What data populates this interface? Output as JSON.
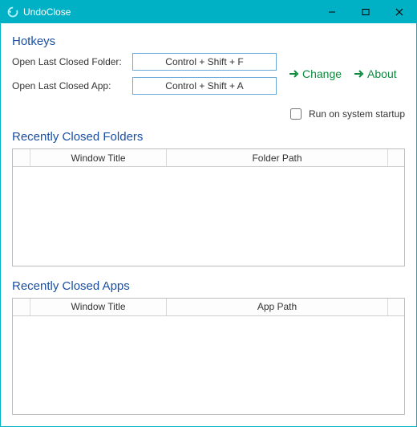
{
  "window": {
    "title": "UndoClose"
  },
  "hotkeys": {
    "section_title": "Hotkeys",
    "folder_label": "Open Last Closed Folder:",
    "folder_value": "Control + Shift + F",
    "app_label": "Open Last Closed App:",
    "app_value": "Control + Shift + A"
  },
  "buttons": {
    "change": "Change",
    "about": "About"
  },
  "startup": {
    "label": "Run on system startup",
    "checked": false
  },
  "folders_table": {
    "title": "Recently Closed Folders",
    "col_window": "Window Title",
    "col_path": "Folder Path",
    "rows": []
  },
  "apps_table": {
    "title": "Recently Closed Apps",
    "col_window": "Window Title",
    "col_path": "App Path",
    "rows": []
  }
}
